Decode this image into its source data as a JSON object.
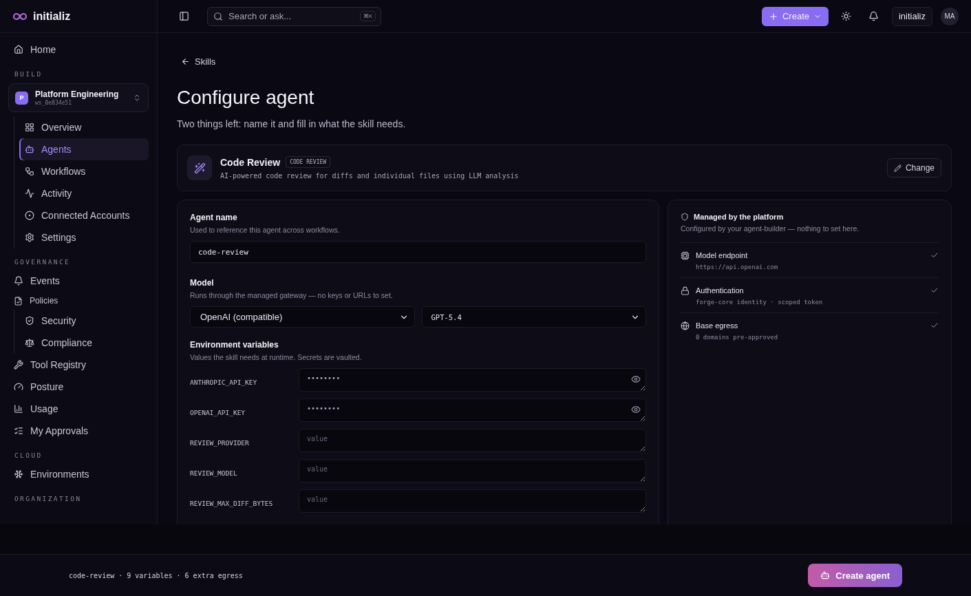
{
  "brand": {
    "name": "initializ"
  },
  "topbar": {
    "search_placeholder": "Search or ask...",
    "search_shortcut": "⌘K",
    "create_label": "Create",
    "org_label": "initializ",
    "avatar": "MA"
  },
  "sidebar": {
    "home": {
      "label": "Home",
      "selected": false
    },
    "sections": [
      {
        "title": "BUILD",
        "workspace": {
          "initial": "P",
          "name": "Platform Engineering",
          "id": "ws_0e834e51"
        },
        "items": [
          {
            "label": "Overview",
            "selected": false
          },
          {
            "label": "Agents",
            "selected": true
          },
          {
            "label": "Workflows",
            "selected": false
          },
          {
            "label": "Activity",
            "selected": false
          },
          {
            "label": "Connected Accounts",
            "selected": false
          },
          {
            "label": "Settings",
            "selected": false
          }
        ]
      },
      {
        "title": "GOVERNANCE",
        "items": [
          {
            "label": "Events",
            "selected": false
          },
          {
            "label": "Policies",
            "selected": false,
            "children": [
              {
                "label": "Security",
                "selected": false
              },
              {
                "label": "Compliance",
                "selected": false
              }
            ]
          },
          {
            "label": "Tool Registry",
            "selected": false
          },
          {
            "label": "Posture",
            "selected": false
          },
          {
            "label": "Usage",
            "selected": false
          },
          {
            "label": "My Approvals",
            "selected": false
          }
        ]
      },
      {
        "title": "CLOUD",
        "items": [
          {
            "label": "Environments",
            "selected": false
          }
        ]
      },
      {
        "title": "ORGANIZATION"
      }
    ]
  },
  "page": {
    "back_label": "Skills",
    "title": "Configure agent",
    "subtitle": "Two things left: name it and fill in what the skill needs.",
    "skill": {
      "name": "Code Review",
      "tag": "CODE REVIEW",
      "description": "AI-powered code review for diffs and individual files using LLM analysis",
      "change_label": "Change"
    },
    "form": {
      "name_label": "Agent name",
      "name_help": "Used to reference this agent across workflows.",
      "name_value": "code-review",
      "model_label": "Model",
      "model_help": "Runs through the managed gateway — no keys or URLs to set.",
      "provider": "OpenAI (compatible)",
      "model": "GPT-5.4",
      "env_label": "Environment variables",
      "env_help": "Values the skill needs at runtime. Secrets are vaulted.",
      "variables": [
        {
          "kind": "secret",
          "name": "ANTHROPIC_API_KEY",
          "value": "••••••••"
        },
        {
          "kind": "secret",
          "name": "OPENAI_API_KEY",
          "value": "••••••••"
        },
        {
          "kind": "plain",
          "name": "REVIEW_PROVIDER",
          "placeholder": "value"
        },
        {
          "kind": "plain",
          "name": "REVIEW_MODEL",
          "placeholder": "value"
        },
        {
          "kind": "plain",
          "name": "REVIEW_MAX_DIFF_BYTES",
          "placeholder": "value"
        }
      ]
    },
    "managed": {
      "title": "Managed by the platform",
      "subtitle": "Configured by your agent-builder — nothing to set here.",
      "items": [
        {
          "title": "Model endpoint",
          "detail": "https://api.openai.com",
          "checked": true
        },
        {
          "title": "Authentication",
          "detail": "forge-core identity · scoped token",
          "checked": true
        },
        {
          "title": "Base egress",
          "detail": "0 domains pre-approved",
          "checked": true
        }
      ]
    }
  },
  "footer": {
    "summary": "code-review · 9 variables · 6 extra egress",
    "create_label": "Create agent"
  }
}
